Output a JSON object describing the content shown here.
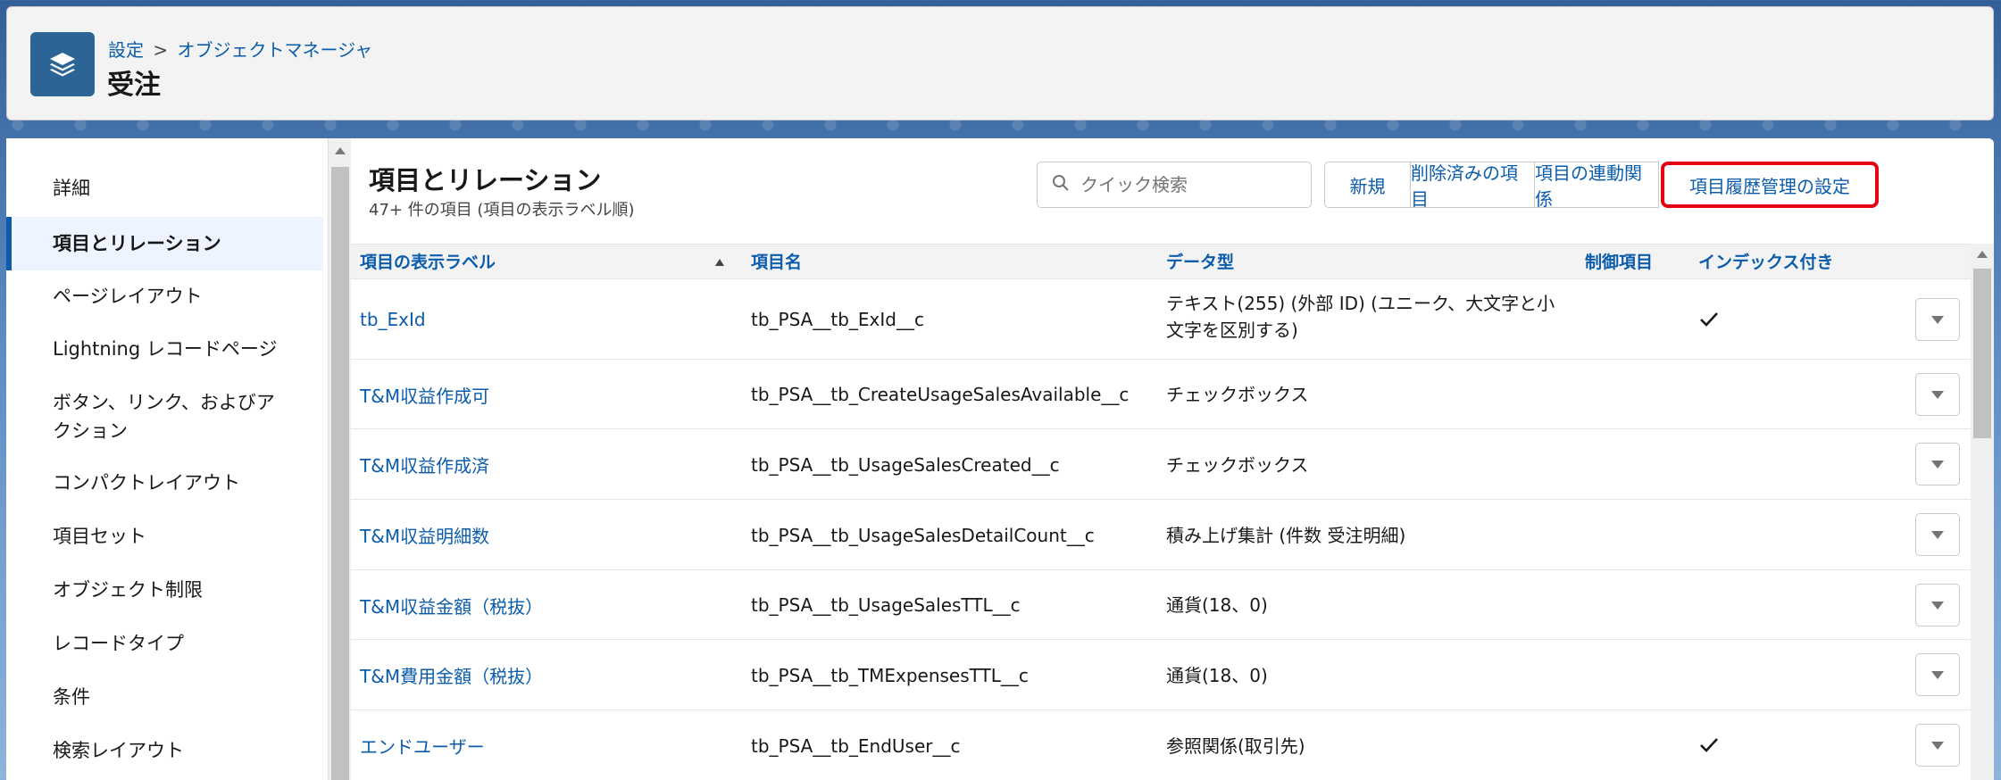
{
  "header": {
    "breadcrumb_root": "設定",
    "breadcrumb_sep": ">",
    "breadcrumb_link": "オブジェクトマネージャ",
    "title": "受注",
    "icon": "layers-icon"
  },
  "sidebar": {
    "items": [
      {
        "label": "詳細",
        "active": false
      },
      {
        "label": "項目とリレーション",
        "active": true
      },
      {
        "label": "ページレイアウト",
        "active": false
      },
      {
        "label": "Lightning レコードページ",
        "active": false
      },
      {
        "label": "ボタン、リンク、およびア",
        "label2": "クション",
        "active": false
      },
      {
        "label": "コンパクトレイアウト",
        "active": false
      },
      {
        "label": "項目セット",
        "active": false
      },
      {
        "label": "オブジェクト制限",
        "active": false
      },
      {
        "label": "レコードタイプ",
        "active": false
      },
      {
        "label": "条件",
        "active": false
      },
      {
        "label": "検索レイアウト",
        "active": false
      }
    ]
  },
  "section": {
    "title": "項目とリレーション",
    "subtitle": "47+ 件の項目 (項目の表示ラベル順)"
  },
  "search": {
    "placeholder": "クイック検索",
    "value": ""
  },
  "buttons": {
    "new": "新規",
    "deleted": "削除済みの項目",
    "dependencies": "項目の連動関係",
    "history": "項目履歴管理の設定"
  },
  "table": {
    "headers": {
      "label": "項目の表示ラベル",
      "api": "項目名",
      "dtype": "データ型",
      "controlling": "制御項目",
      "indexed": "インデックス付き"
    },
    "rows": [
      {
        "label": "tb_ExId",
        "api": "tb_PSA__tb_ExId__c",
        "dtype": "テキスト(255) (外部 ID) (ユニーク、大文字と小",
        "dtype2": "文字を区別する)",
        "indexed": true
      },
      {
        "label": "T&M収益作成可",
        "api": "tb_PSA__tb_CreateUsageSalesAvailable__c",
        "dtype": "チェックボックス",
        "dtype2": "",
        "indexed": false
      },
      {
        "label": "T&M収益作成済",
        "api": "tb_PSA__tb_UsageSalesCreated__c",
        "dtype": "チェックボックス",
        "dtype2": "",
        "indexed": false
      },
      {
        "label": "T&M収益明細数",
        "api": "tb_PSA__tb_UsageSalesDetailCount__c",
        "dtype": "積み上げ集計 (件数 受注明細)",
        "dtype2": "",
        "indexed": false
      },
      {
        "label": "T&M収益金額（税抜）",
        "api": "tb_PSA__tb_UsageSalesTTL__c",
        "dtype": "通貨(18、0)",
        "dtype2": "",
        "indexed": false
      },
      {
        "label": "T&M費用金額（税抜）",
        "api": "tb_PSA__tb_TMExpensesTTL__c",
        "dtype": "通貨(18、0)",
        "dtype2": "",
        "indexed": false
      },
      {
        "label": "エンドユーザー",
        "api": "tb_PSA__tb_EndUser__c",
        "dtype": "参照関係(取引先)",
        "dtype2": "",
        "indexed": true
      }
    ]
  },
  "colors": {
    "link": "#0b5cab",
    "highlight_border": "#e60012",
    "header_icon_bg": "#2c6496"
  }
}
